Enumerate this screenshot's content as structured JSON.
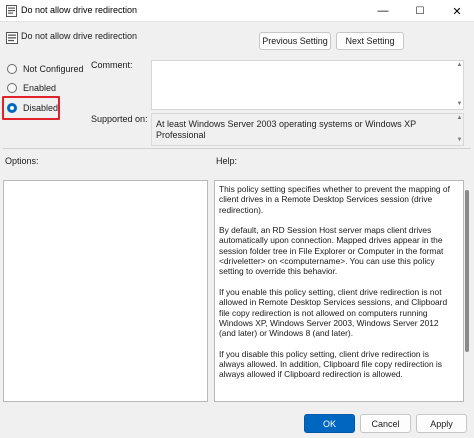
{
  "window": {
    "title": "Do not allow drive redirection",
    "controls": {
      "minimize": "—",
      "maximize": "☐",
      "close": "✕"
    }
  },
  "header": {
    "title": "Do not allow drive redirection",
    "previous_label": "Previous Setting",
    "next_label": "Next Setting"
  },
  "state_options": [
    {
      "label": "Not Configured",
      "checked": false
    },
    {
      "label": "Enabled",
      "checked": false
    },
    {
      "label": "Disabled",
      "checked": true
    }
  ],
  "comment": {
    "label": "Comment:",
    "value": ""
  },
  "supported_on": {
    "label": "Supported on:",
    "value": "At least Windows Server 2003 operating systems or Windows XP Professional"
  },
  "options": {
    "label": "Options:"
  },
  "help": {
    "label": "Help:",
    "paragraphs": [
      "This policy setting specifies whether to prevent the mapping of client drives in a Remote Desktop Services session (drive redirection).",
      "By default, an RD Session Host server maps client drives automatically upon connection. Mapped drives appear in the session folder tree in File Explorer or Computer in the format <driveletter> on <computername>. You can use this policy setting to override this behavior.",
      "If you enable this policy setting, client drive redirection is not allowed in Remote Desktop Services sessions, and Clipboard file copy redirection is not allowed on computers running Windows XP, Windows Server 2003, Windows Server 2012 (and later) or Windows 8 (and later).",
      "If you disable this policy setting, client drive redirection is always allowed. In addition, Clipboard file copy redirection is always allowed if Clipboard redirection is allowed."
    ]
  },
  "footer": {
    "ok_label": "OK",
    "cancel_label": "Cancel",
    "apply_label": "Apply"
  },
  "colors": {
    "accent": "#0067c0",
    "highlight": "#e0202a"
  }
}
